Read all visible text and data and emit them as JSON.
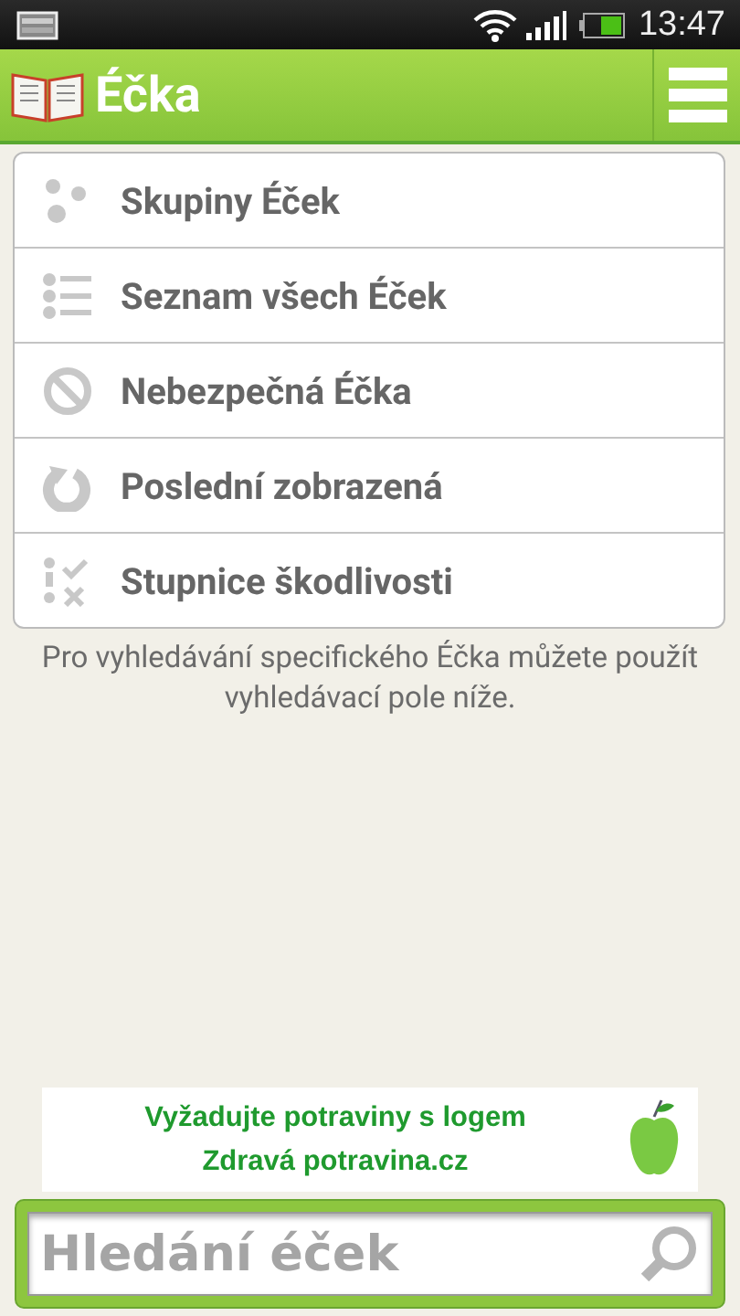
{
  "status_bar": {
    "time": "13:47"
  },
  "app_bar": {
    "title": "Éčka"
  },
  "menu": [
    {
      "kind": "groups",
      "label": "Skupiny Éček"
    },
    {
      "kind": "list",
      "label": "Seznam všech Éček"
    },
    {
      "kind": "danger",
      "label": "Nebezpečná Éčka"
    },
    {
      "kind": "recent",
      "label": "Poslední zobrazená"
    },
    {
      "kind": "scale",
      "label": "Stupnice škodlivosti"
    }
  ],
  "hint": "Pro vyhledávání specifického Éčka můžete použít vyhledávací pole níže.",
  "banner": {
    "line_1": "Vyžadujte potraviny s logem",
    "line_2": "Zdravá potravina.cz"
  },
  "search": {
    "placeholder": "Hledání éček"
  }
}
